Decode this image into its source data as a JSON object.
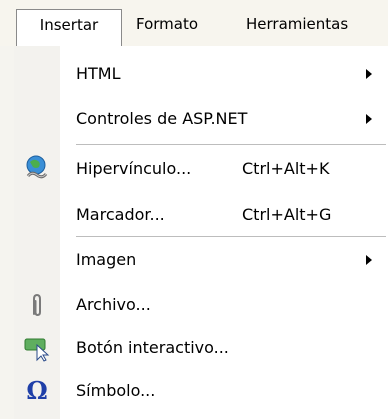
{
  "menubar": {
    "items": [
      {
        "label": "Insertar"
      },
      {
        "label": "Formato"
      },
      {
        "label": "Herramientas"
      }
    ]
  },
  "menu": {
    "items": [
      {
        "label": "HTML",
        "shortcut": "",
        "submenu": true
      },
      {
        "label": "Controles de ASP.NET",
        "shortcut": "",
        "submenu": true
      },
      {
        "label": "Hipervínculo...",
        "shortcut": "Ctrl+Alt+K",
        "icon": "hyperlink-globe-icon"
      },
      {
        "label": "Marcador...",
        "shortcut": "Ctrl+Alt+G"
      },
      {
        "label": "Imagen",
        "shortcut": "",
        "submenu": true
      },
      {
        "label": "Archivo...",
        "shortcut": "",
        "icon": "paperclip-icon"
      },
      {
        "label": "Botón interactivo...",
        "shortcut": "",
        "icon": "interactive-button-icon"
      },
      {
        "label": "Símbolo...",
        "shortcut": "",
        "icon": "omega-symbol-icon"
      }
    ]
  },
  "colors": {
    "menubar_bg": "#f7f5ee",
    "gutter_bg": "#f3f2ee",
    "omega_blue": "#1f3fa8"
  }
}
